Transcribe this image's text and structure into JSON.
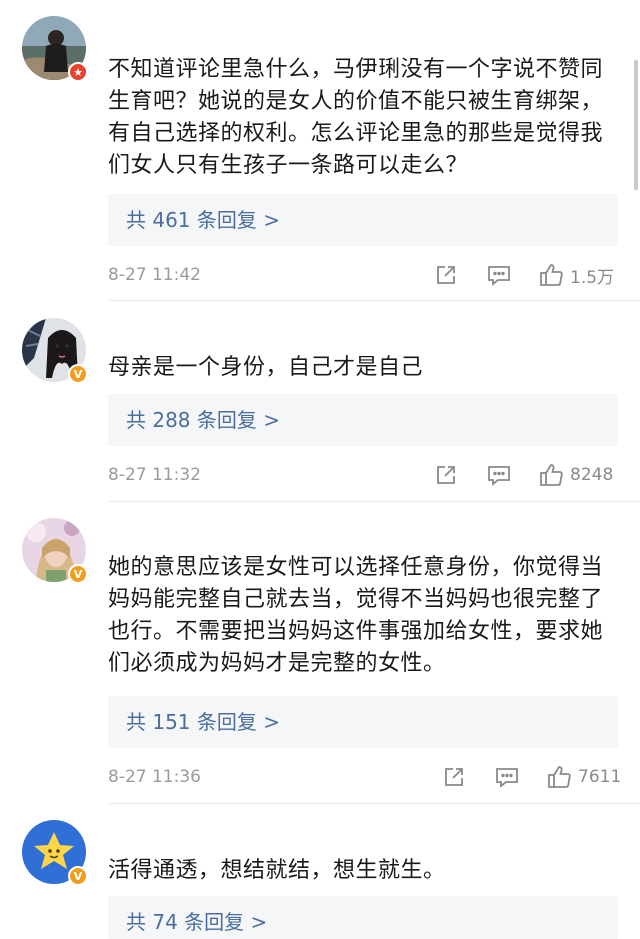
{
  "comments": [
    {
      "text": "不知道评论里急什么，马伊琍没有一个字说不赞同生育吧？她说的是女人的价值不能只被生育绑架，有自己选择的权利。怎么评论里急的那些是觉得我们女人只有生孩子一条路可以走么？",
      "replies": "共 461 条回复 >",
      "time": "8-27 11:42",
      "likes": "1.5万",
      "badge_color": "#e8412d"
    },
    {
      "text": "母亲是一个身份，自己才是自己",
      "replies": "共 288 条回复 >",
      "time": "8-27 11:32",
      "likes": "8248",
      "badge_color": "#f29d1f"
    },
    {
      "text": "她的意思应该是女性可以选择任意身份，你觉得当妈妈能完整自己就去当，觉得不当妈妈也很完整了也行。不需要把当妈妈这件事强加给女性，要求她们必须成为妈妈才是完整的女性。",
      "replies": "共 151 条回复 >",
      "time": "8-27 11:36",
      "likes": "7611",
      "badge_color": "#f29d1f"
    },
    {
      "text": "活得通透，想结就结，想生就生。",
      "replies": "共 74 条回复 >",
      "badge_color": "#f29d1f"
    }
  ],
  "icons": {
    "share": "share-icon",
    "comment": "comment-icon",
    "like": "thumbs-up-icon"
  }
}
